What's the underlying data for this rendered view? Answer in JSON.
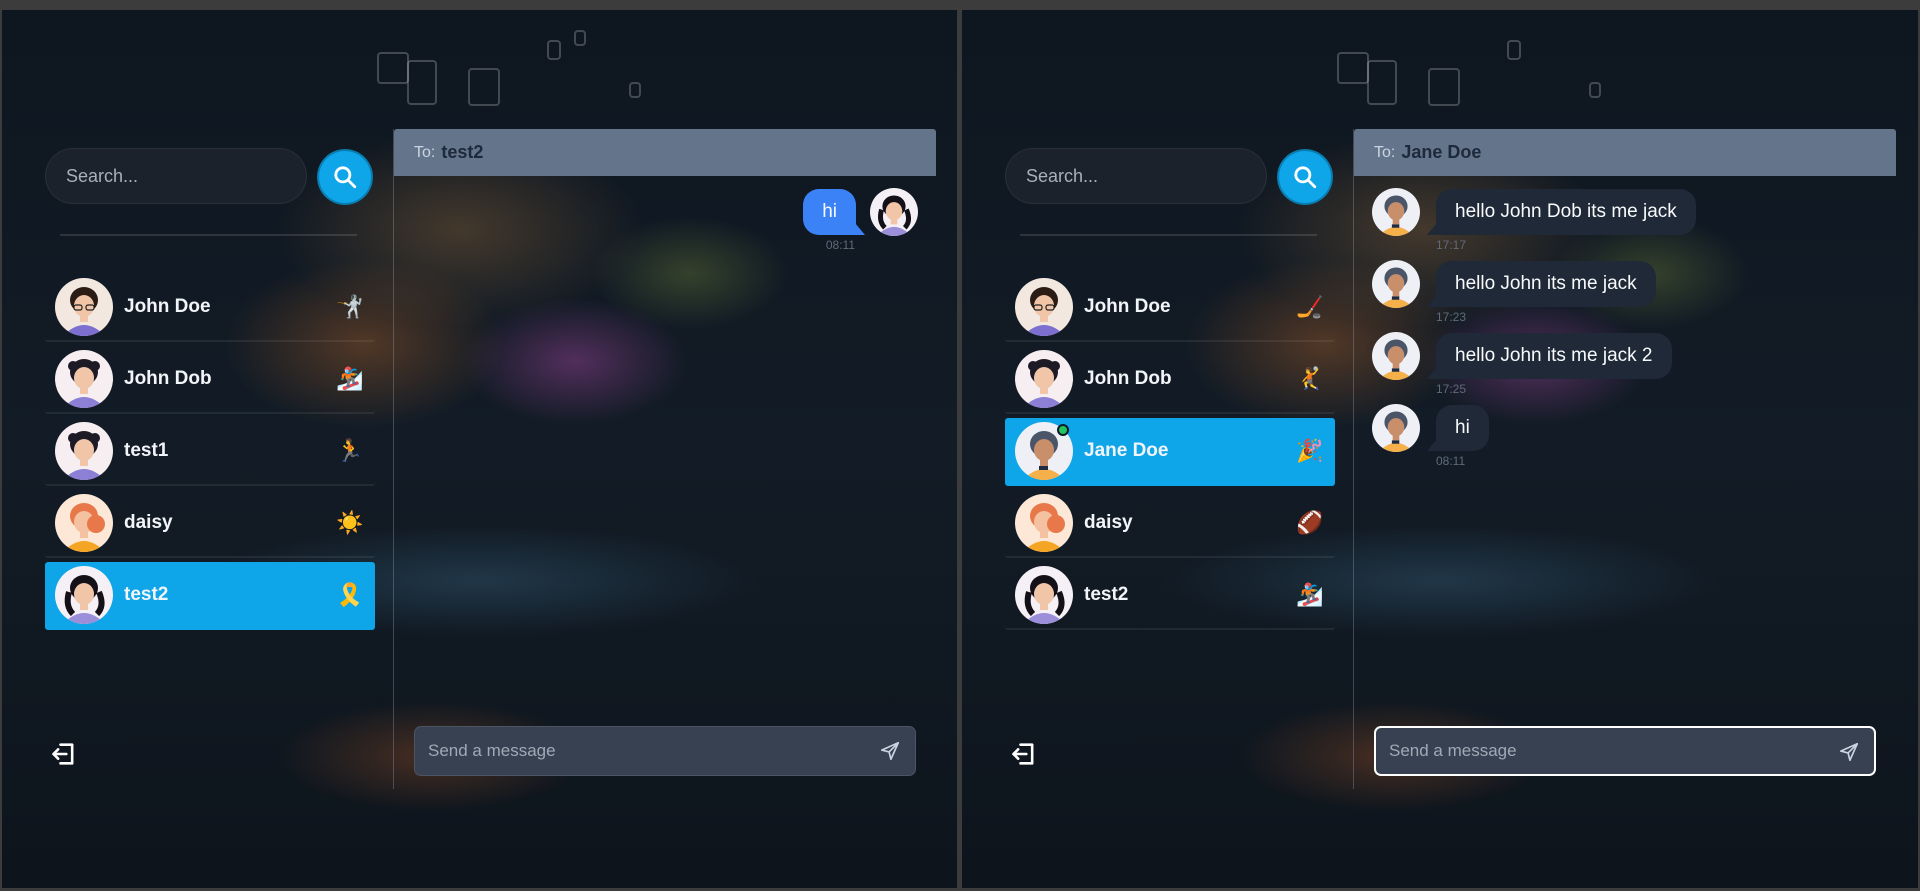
{
  "colors": {
    "accent": "#0ea5e9",
    "outgoing_bubble": "#3b82f6",
    "incoming_bubble": "#1f2937",
    "header": "#64748b",
    "online": "#22c55e"
  },
  "left": {
    "search": {
      "placeholder": "Search...",
      "button_icon": "search-icon"
    },
    "contacts": [
      {
        "name": "John Doe",
        "emoji": "🤺",
        "avatar": "man-glasses"
      },
      {
        "name": "John Dob",
        "emoji": "🏂",
        "avatar": "man-curly"
      },
      {
        "name": "test1",
        "emoji": "🏃",
        "avatar": "man-curly"
      },
      {
        "name": "daisy",
        "emoji": "☀️",
        "avatar": "woman-orange"
      },
      {
        "name": "test2",
        "emoji": "🎗️",
        "avatar": "woman-dark",
        "selected": true
      }
    ],
    "chat": {
      "to_label": "To:",
      "to_name": "test2",
      "messages": [
        {
          "direction": "out",
          "text": "hi",
          "time": "08:11"
        }
      ],
      "composer_placeholder": "Send a message"
    }
  },
  "right": {
    "search": {
      "placeholder": "Search...",
      "button_icon": "search-icon"
    },
    "contacts": [
      {
        "name": "John Doe",
        "emoji": "🏒",
        "avatar": "man-glasses"
      },
      {
        "name": "John Dob",
        "emoji": "🤾",
        "avatar": "man-curly"
      },
      {
        "name": "Jane Doe",
        "emoji": "🎉",
        "avatar": "woman-hijab",
        "selected": true,
        "online": true
      },
      {
        "name": "daisy",
        "emoji": "🏈",
        "avatar": "woman-orange"
      },
      {
        "name": "test2",
        "emoji": "🏂",
        "avatar": "woman-dark"
      }
    ],
    "chat": {
      "to_label": "To:",
      "to_name": "Jane Doe",
      "messages": [
        {
          "direction": "in",
          "text": "hello John Dob its me jack",
          "time": "17:17"
        },
        {
          "direction": "in",
          "text": "hello John its me jack",
          "time": "17:23"
        },
        {
          "direction": "in",
          "text": "hello John its me jack 2",
          "time": "17:25"
        },
        {
          "direction": "in",
          "text": "hi",
          "time": "08:11"
        }
      ],
      "composer_placeholder": "Send a message",
      "composer_focused": true
    }
  }
}
